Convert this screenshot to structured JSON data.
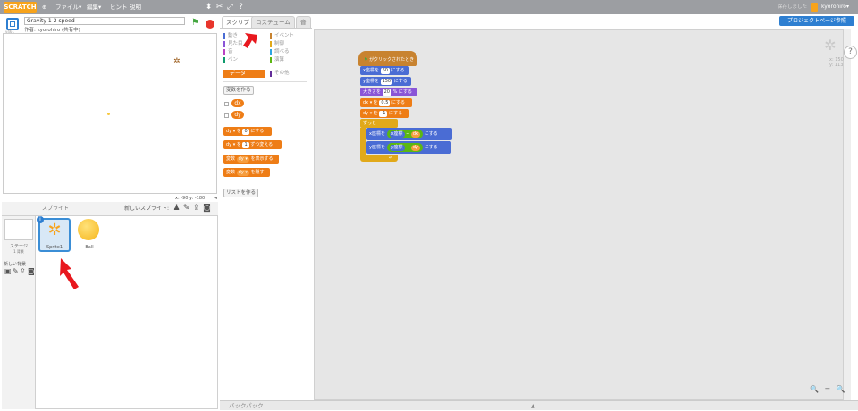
{
  "topbar": {
    "logo": "SCRATCH",
    "menu": [
      "ファイル▾",
      "編集▾",
      "ヒント",
      "説明"
    ],
    "saved": "保存しました",
    "user": "kyorohiro▾"
  },
  "stage": {
    "version": "v461",
    "title": "Gravity 1-2 speed",
    "author": "作者: kyorohiro (共有中)",
    "coords": "x: -90   y: -180"
  },
  "sprites": {
    "title": "スプライト",
    "new_label": "新しいスプライト:",
    "stage_label": "ステージ",
    "bg_count": "1 背景",
    "new_bg": "新しい背景",
    "items": [
      {
        "name": "Sprite1"
      },
      {
        "name": "Ball"
      }
    ]
  },
  "tabs": [
    "スクリプト",
    "コスチューム",
    "音"
  ],
  "categories": [
    [
      "動き",
      "イベント"
    ],
    [
      "見た目",
      "制御"
    ],
    [
      "音",
      "調べる"
    ],
    [
      "ペン",
      "演算"
    ],
    [
      "データ",
      "その他"
    ]
  ],
  "palette": {
    "make_var": "変数を作る",
    "vars": [
      "dx",
      "dy"
    ],
    "blocks": [
      {
        "pre": "dy ▾",
        "mid": "を",
        "val": "0",
        "post": "にする"
      },
      {
        "pre": "dy ▾",
        "mid": "を",
        "val": "1",
        "post": "ずつ変える"
      },
      {
        "pre": "変数",
        "var": "dy ▾",
        "post": "を表示する"
      },
      {
        "pre": "変数",
        "var": "dy ▾",
        "post": "を隠す"
      }
    ],
    "make_list": "リストを作る"
  },
  "script": {
    "hat": "がクリックされたとき",
    "lines": [
      {
        "t": "x座標を",
        "v": "60",
        "p": "にする",
        "c": "#4a6cd4"
      },
      {
        "t": "y座標を",
        "v": "150",
        "p": "にする",
        "c": "#4a6cd4"
      },
      {
        "t": "大きさを",
        "v": "20",
        "p": "% にする",
        "c": "#8a55d7"
      },
      {
        "t": "dx ▾ を",
        "v": "0.5",
        "p": "にする",
        "c": "#ee7d16"
      },
      {
        "t": "dy ▾ を",
        "v": "-1",
        "p": "にする",
        "c": "#ee7d16"
      }
    ],
    "forever": "ずっと",
    "inner": [
      {
        "t": "x座標を",
        "a": "x座標",
        "op": "+",
        "b": "dx",
        "p": "にする"
      },
      {
        "t": "y座標を",
        "a": "y座標",
        "op": "+",
        "b": "dy",
        "p": "にする"
      }
    ]
  },
  "sa": {
    "xy": "x: 150\ny: 113",
    "help": "?",
    "zoom": "🔍 = 🔍"
  },
  "project_page": "プロジェクトページ参照",
  "backpack": "バックパック",
  "colors": {
    "motion": "#4a6cd4",
    "looks": "#8a55d7",
    "data": "#ee7d16",
    "events": "#c88330",
    "control": "#e1a91a"
  }
}
